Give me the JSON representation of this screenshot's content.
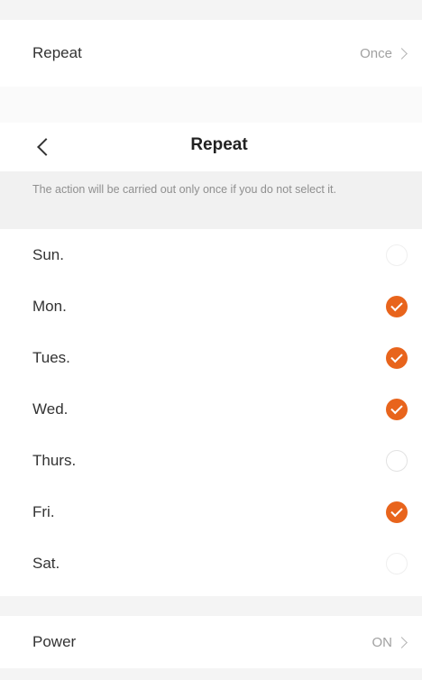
{
  "settings": {
    "repeat_label": "Repeat",
    "repeat_value": "Once",
    "power_label": "Power",
    "power_value": "ON"
  },
  "picker": {
    "title": "Repeat",
    "notice": "The action will be carried out only once if you do not select it.",
    "days": [
      {
        "label": "Sun.",
        "checked": false
      },
      {
        "label": "Mon.",
        "checked": true
      },
      {
        "label": "Tues.",
        "checked": true
      },
      {
        "label": "Wed.",
        "checked": true
      },
      {
        "label": "Thurs.",
        "checked": false
      },
      {
        "label": "Fri.",
        "checked": true
      },
      {
        "label": "Sat.",
        "checked": false
      }
    ]
  },
  "colors": {
    "accent": "#e8641c",
    "notice_background": "#f1f1f1",
    "divider_background": "#f4f4f4"
  },
  "icons": {
    "back": "chevron-left-icon",
    "disclosure": "chevron-right-icon",
    "check": "checkmark-icon"
  }
}
